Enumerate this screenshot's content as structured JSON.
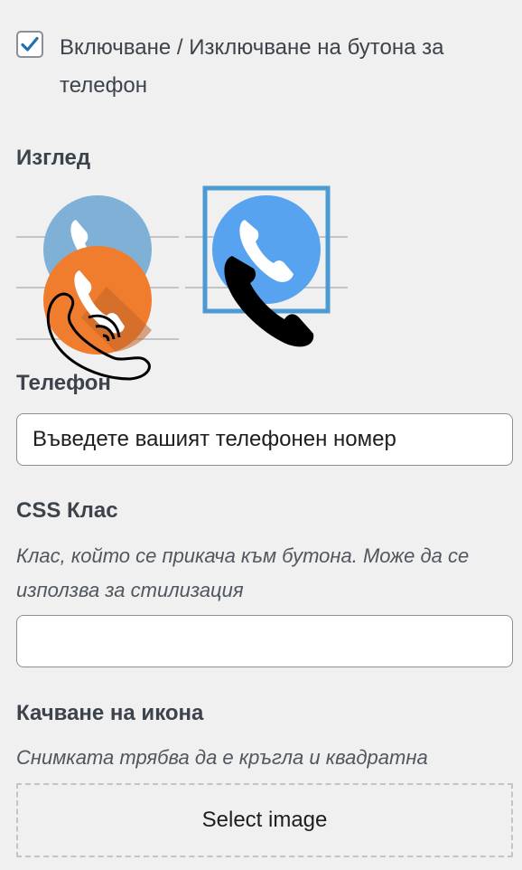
{
  "toggle": {
    "label": "Включване / Изключване на бутона за телефон",
    "checked": true
  },
  "appearance": {
    "title": "Изглед",
    "options": [
      {
        "name": "blue-orange-outline-phone"
      },
      {
        "name": "blue-black-phone",
        "selected": true
      }
    ]
  },
  "phone": {
    "title": "Телефон",
    "placeholder": "Въведете вашият телефонен номер"
  },
  "css_class": {
    "title": "CSS Клас",
    "help": "Клас, който се прикача към бутона. Може да се използва за стилизация",
    "value": ""
  },
  "icon_upload": {
    "title": "Качване на икона",
    "help": "Снимката трябва да е кръгла и квадратна",
    "button_label": "Select image"
  },
  "colors": {
    "accent_selected": "#4b9ad3",
    "checkbox_check": "#2271b1",
    "blue_light": "#7fb0d6",
    "blue_bright": "#57a3ef",
    "orange": "#f07c2e"
  }
}
